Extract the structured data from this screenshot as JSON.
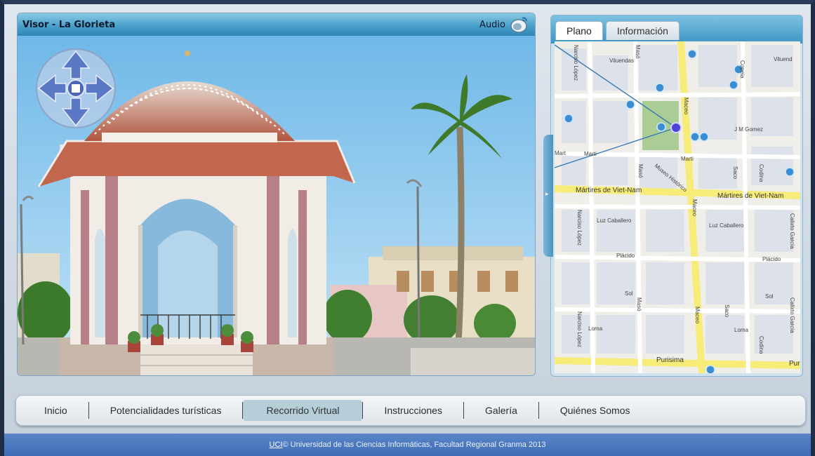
{
  "viewer": {
    "title": "Visor - La Glorieta",
    "audio_label": "Audio"
  },
  "map": {
    "tabs": [
      {
        "label": "Plano",
        "active": true
      },
      {
        "label": "Información",
        "active": false
      }
    ],
    "street_labels": {
      "viluendas_1": "Viluendas",
      "viluendas_2": "Viluend",
      "narciso_lopez_top": "Narciso López",
      "copeia": "Copeia",
      "maceo_top": "Maceo",
      "jm_gomez": "J M Gomez",
      "marti_left_1": "Mart",
      "marti_left_2": "Marti",
      "marti_right": "Marti",
      "maso_top": "Masó",
      "museo": "Museo Histórico",
      "saco_top": "Saco",
      "codina_top": "Codina",
      "martires_1": "Mártires de Viet-Nam",
      "martires_2": "Mártires de Viet-Nam",
      "maceo_mid": "Maceo",
      "luz_caballero_1": "Luz Caballero",
      "luz_caballero_2": "Luz Caballero",
      "narciso_lopez_mid": "Narciso López",
      "calixto_garcia_mid": "Calixto García",
      "placido_1": "Plácido",
      "placido_2": "Plácido",
      "sol_1": "Sol",
      "sol_2": "Sol",
      "maso_bottom": "Masó",
      "maceo_bottom": "Maceo",
      "saco_bottom": "Saco",
      "calixto_garcia_bottom": "Calixto García",
      "narciso_lopez_bottom": "Narciso López",
      "loma_1": "Loma",
      "loma_2": "Loma",
      "codina_bottom": "Codina",
      "purisima": "Purisima",
      "pur": "Pur"
    }
  },
  "nav": {
    "items": [
      {
        "label": "Inicio",
        "active": false
      },
      {
        "label": "Potencialidades turísticas",
        "active": false
      },
      {
        "label": "Recorrido Virtual",
        "active": true
      },
      {
        "label": "Instrucciones",
        "active": false
      },
      {
        "label": "Galería",
        "active": false
      },
      {
        "label": "Quiénes Somos",
        "active": false
      }
    ]
  },
  "footer": {
    "link": "UCI",
    "text": " © Universidad de las Ciencias Informáticas, Facultad Regional Granma 2013"
  },
  "colors": {
    "header_blue": "#4aa1cb",
    "footer_blue": "#4a78be",
    "active_tab": "#b5ced8",
    "map_road_yellow": "#f7ef8a",
    "marker_blue": "#3a8fd4"
  }
}
